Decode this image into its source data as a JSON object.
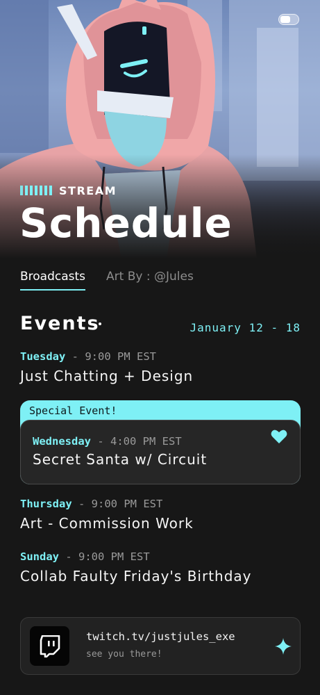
{
  "hero": {
    "kicker": "STREAM",
    "title": "Schedule"
  },
  "tabs": [
    {
      "label": "Broadcasts",
      "active": true
    },
    {
      "label": "Art By : @Jules",
      "active": false
    }
  ],
  "events": {
    "title": "Events",
    "date_range": "January 12 - 18",
    "items": [
      {
        "day": "Tuesday",
        "time": "- 9:00 PM EST",
        "name": "Just Chatting + Design"
      },
      {
        "day": "Wednesday",
        "time": "- 4:00 PM EST",
        "name": "Secret Santa w/ Circuit",
        "special_label": "Special Event!"
      },
      {
        "day": "Thursday",
        "time": "- 9:00 PM EST",
        "name": "Art - Commission Work"
      },
      {
        "day": "Sunday",
        "time": "- 9:00 PM EST",
        "name": "Collab Faulty Friday's Birthday"
      }
    ]
  },
  "link": {
    "url": "twitch.tv/justjules_exe",
    "subtitle": "see you there!"
  },
  "icons": {
    "toggle": "toggle-switch-icon",
    "heart": "heart-icon",
    "twitch": "twitch-logo-icon",
    "sparkle": "sparkle-icon"
  },
  "colors": {
    "accent": "#7ef0f5",
    "background": "#171717",
    "card": "#262626"
  }
}
